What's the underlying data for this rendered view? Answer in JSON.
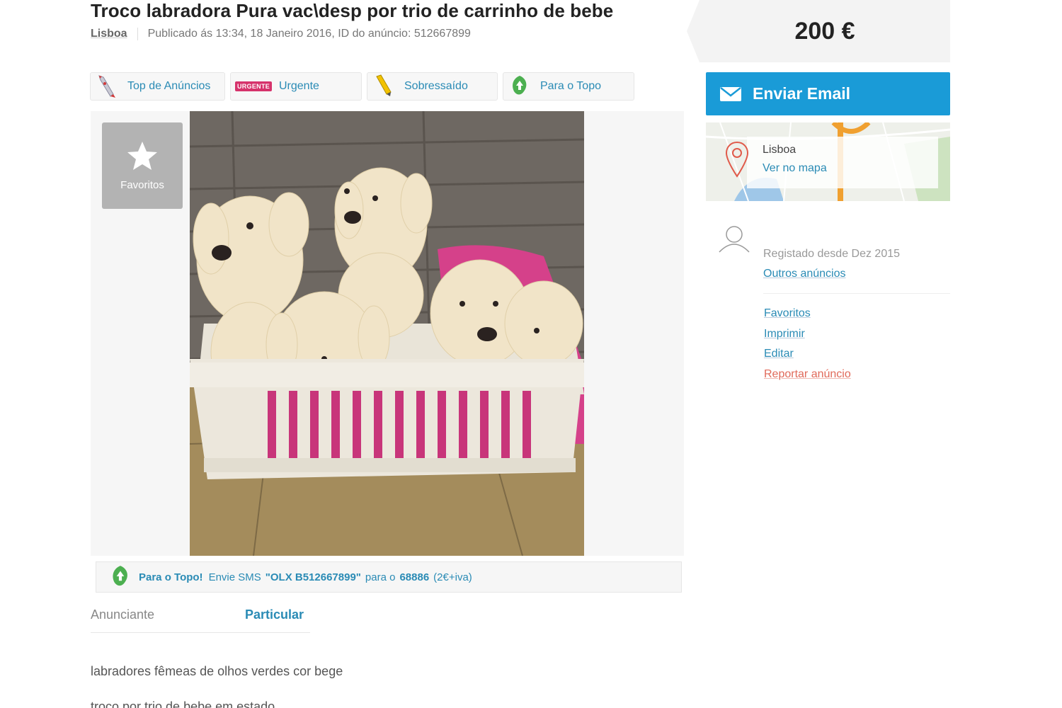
{
  "header": {
    "title": "Troco labradora Pura vac\\desp por trio de carrinho de bebe",
    "location": "Lisboa",
    "published": "Publicado ás 13:34, 18 Janeiro 2016, ID do anúncio: 512667899"
  },
  "price": "200 €",
  "promo_buttons": [
    {
      "label": "Top de Anúncios",
      "icon": "rocket-icon"
    },
    {
      "label": "Urgente",
      "icon": "urgente-tag-icon",
      "tag": "URGENTE"
    },
    {
      "label": "Sobressaído",
      "icon": "highlighter-pen-icon"
    },
    {
      "label": "Para o Topo",
      "icon": "green-leaf-arrow-icon"
    }
  ],
  "gallery": {
    "favorite_label": "Favoritos"
  },
  "sms_bar": {
    "lead": "Para o Topo!",
    "text1": "Envie SMS",
    "code": "\"OLX B512667899\"",
    "text2": "para o",
    "number": "68886",
    "price_note": "(2€+iva)"
  },
  "advertiser": {
    "label": "Anunciante",
    "value": "Particular"
  },
  "description": {
    "line1": "labradores fêmeas de olhos verdes cor bege",
    "line2": "troco por trio de bebe em estado"
  },
  "sidebar": {
    "email_button": "Enviar Email",
    "map_city": "Lisboa",
    "map_link": "Ver no mapa",
    "registered": "Registado desde Dez 2015",
    "other_ads": "Outros anúncios",
    "links": {
      "favorites": "Favoritos",
      "print": "Imprimir",
      "edit": "Editar",
      "report": "Reportar anúncio"
    }
  },
  "colors": {
    "accent_blue": "#1a9bd7",
    "link_blue": "#2a8bb5",
    "report_red": "#e06a5a"
  }
}
